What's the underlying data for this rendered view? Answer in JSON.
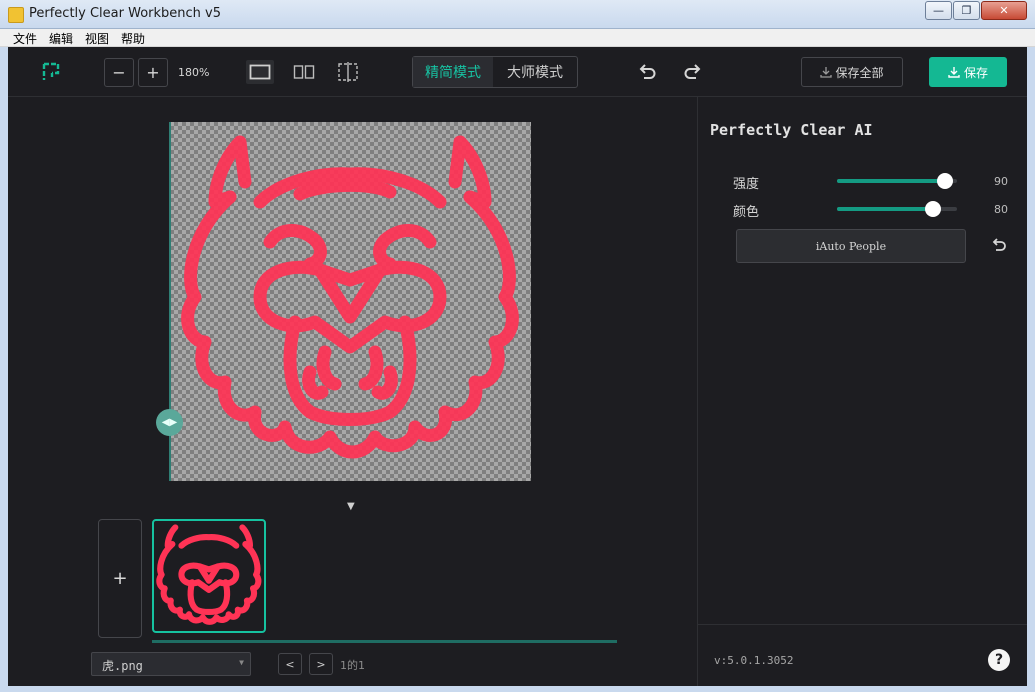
{
  "window": {
    "title": "Perfectly Clear Workbench v5",
    "minimize": "—",
    "restore": "❐",
    "close": "✕"
  },
  "menu": {
    "items": [
      "文件",
      "编辑",
      "视图",
      "帮助"
    ]
  },
  "toolbar": {
    "zoom_out": "−",
    "zoom_in": "+",
    "zoom_level": "180%",
    "mode_simple": "精简模式",
    "mode_master": "大师模式",
    "save_all": "保存全部",
    "save": "保存",
    "active_mode": "精简模式"
  },
  "canvas": {
    "collapse_arrow": "▼",
    "add_image": "+",
    "filename": "虎.png",
    "page_indicator": "1的1",
    "prev": "<",
    "next": ">"
  },
  "panel": {
    "title": "Perfectly Clear AI",
    "sliders": [
      {
        "label": "强度",
        "value": "90",
        "fraction": 0.9
      },
      {
        "label": "颜色",
        "value": "80",
        "fraction": 0.8
      }
    ],
    "auto_people": "iAuto People",
    "version": "v:5.0.1.3052",
    "help": "?"
  },
  "colors": {
    "accent": "#14b893",
    "background": "#1d1d21",
    "artwork": "#ff3355"
  },
  "icons": [
    "app-logo-icon",
    "single-view-icon",
    "split-view-icon",
    "crop-view-icon",
    "undo-icon",
    "redo-icon",
    "download-icon",
    "reset-icon"
  ]
}
